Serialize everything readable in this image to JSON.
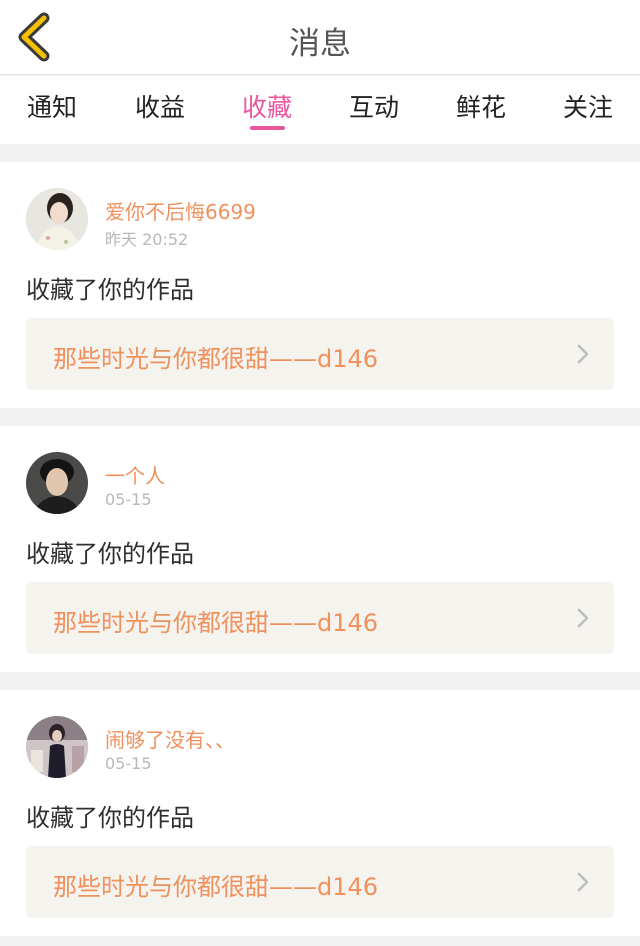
{
  "header": {
    "title": "消息",
    "back_icon": "chevron-left-icon",
    "accent_color": "#f5c000"
  },
  "tabs": [
    {
      "label": "通知",
      "active": false
    },
    {
      "label": "收益",
      "active": false
    },
    {
      "label": "收藏",
      "active": true
    },
    {
      "label": "互动",
      "active": false
    },
    {
      "label": "鲜花",
      "active": false
    },
    {
      "label": "关注",
      "active": false
    }
  ],
  "colors": {
    "active_tab": "#e9579f",
    "username": "#f0905d",
    "link_bg": "#f5f3ee"
  },
  "items": [
    {
      "username": "爱你不后悔6699",
      "time": "昨天 20:52",
      "action": "收藏了你的作品",
      "work_title": "那些时光与你都很甜——d146"
    },
    {
      "username": "一个人",
      "time": "05-15",
      "action": "收藏了你的作品",
      "work_title": "那些时光与你都很甜——d146"
    },
    {
      "username": "闹够了没有、、",
      "time": "05-15",
      "action": "收藏了你的作品",
      "work_title": "那些时光与你都很甜——d146"
    }
  ]
}
